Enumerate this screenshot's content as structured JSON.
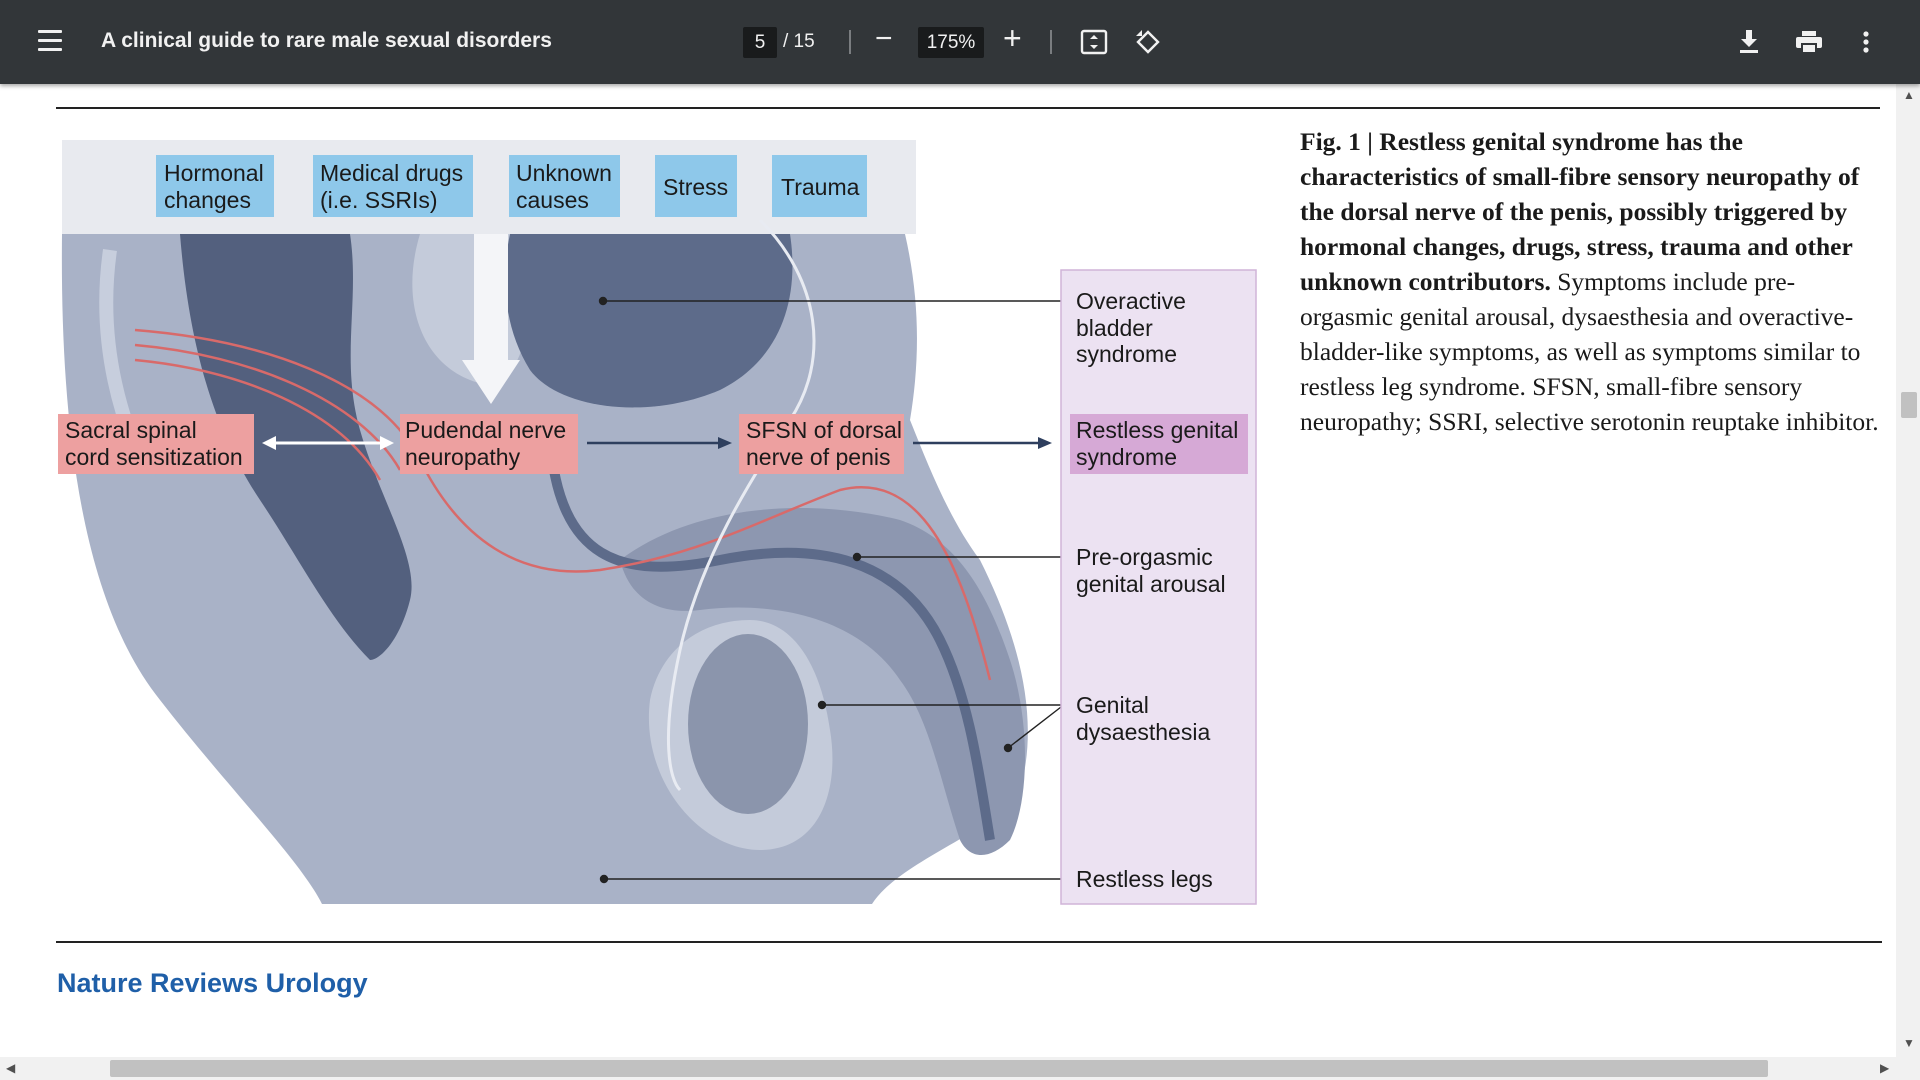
{
  "toolbar": {
    "title": "A clinical guide to rare male sexual disorders",
    "current_page": "5",
    "page_total": "/ 15",
    "zoom": "175%",
    "zoom_out_label": "−",
    "zoom_in_label": "+",
    "icons": [
      "menu-icon",
      "fit-page-icon",
      "rotate-icon",
      "download-icon",
      "print-icon",
      "more-vert-icon"
    ]
  },
  "figure": {
    "triggers": [
      {
        "line1": "Hormonal",
        "line2": "changes"
      },
      {
        "line1": "Medical drugs",
        "line2": "(i.e. SSRIs)"
      },
      {
        "line1": "Unknown",
        "line2": "causes"
      },
      {
        "line1": "Stress",
        "line2": ""
      },
      {
        "line1": "Trauma",
        "line2": ""
      }
    ],
    "chain": [
      {
        "line1": "Sacral spinal",
        "line2": "cord sensitization"
      },
      {
        "line1": "Pudendal nerve",
        "line2": "neuropathy"
      },
      {
        "line1": "SFSN of dorsal",
        "line2": "nerve of penis"
      }
    ],
    "symptoms": [
      {
        "line1": "Overactive",
        "line2": "bladder",
        "line3": "syndrome"
      },
      {
        "line1": "Restless genital",
        "line2": "syndrome",
        "line3": ""
      },
      {
        "line1": "Pre-orgasmic",
        "line2": "genital arousal",
        "line3": ""
      },
      {
        "line1": "Genital",
        "line2": "dysaesthesia",
        "line3": ""
      },
      {
        "line1": "Restless legs",
        "line2": "",
        "line3": ""
      }
    ],
    "colors": {
      "trigger_box": "#8ec8ea",
      "chain_box": "#eda0a0",
      "symptom_panel": "#ece2f2",
      "rgs_box": "#d6a9d6"
    }
  },
  "caption": {
    "bold": "Fig. 1 | Restless genital syndrome has the characteristics of small-fibre sensory neuropathy of the dorsal nerve of the penis, possibly triggered by hormonal changes, drugs, stress, trauma and other unknown contributors.",
    "normal": " Symptoms include pre-orgasmic genital arousal, dysaesthesia and overactive-bladder-like symptoms, as well as symptoms similar to restless leg syndrome. SFSN, small-fibre sensory neuropathy; SSRI, selective serotonin reuptake inhibitor."
  },
  "footer": {
    "journal": "Nature Reviews Urology"
  }
}
